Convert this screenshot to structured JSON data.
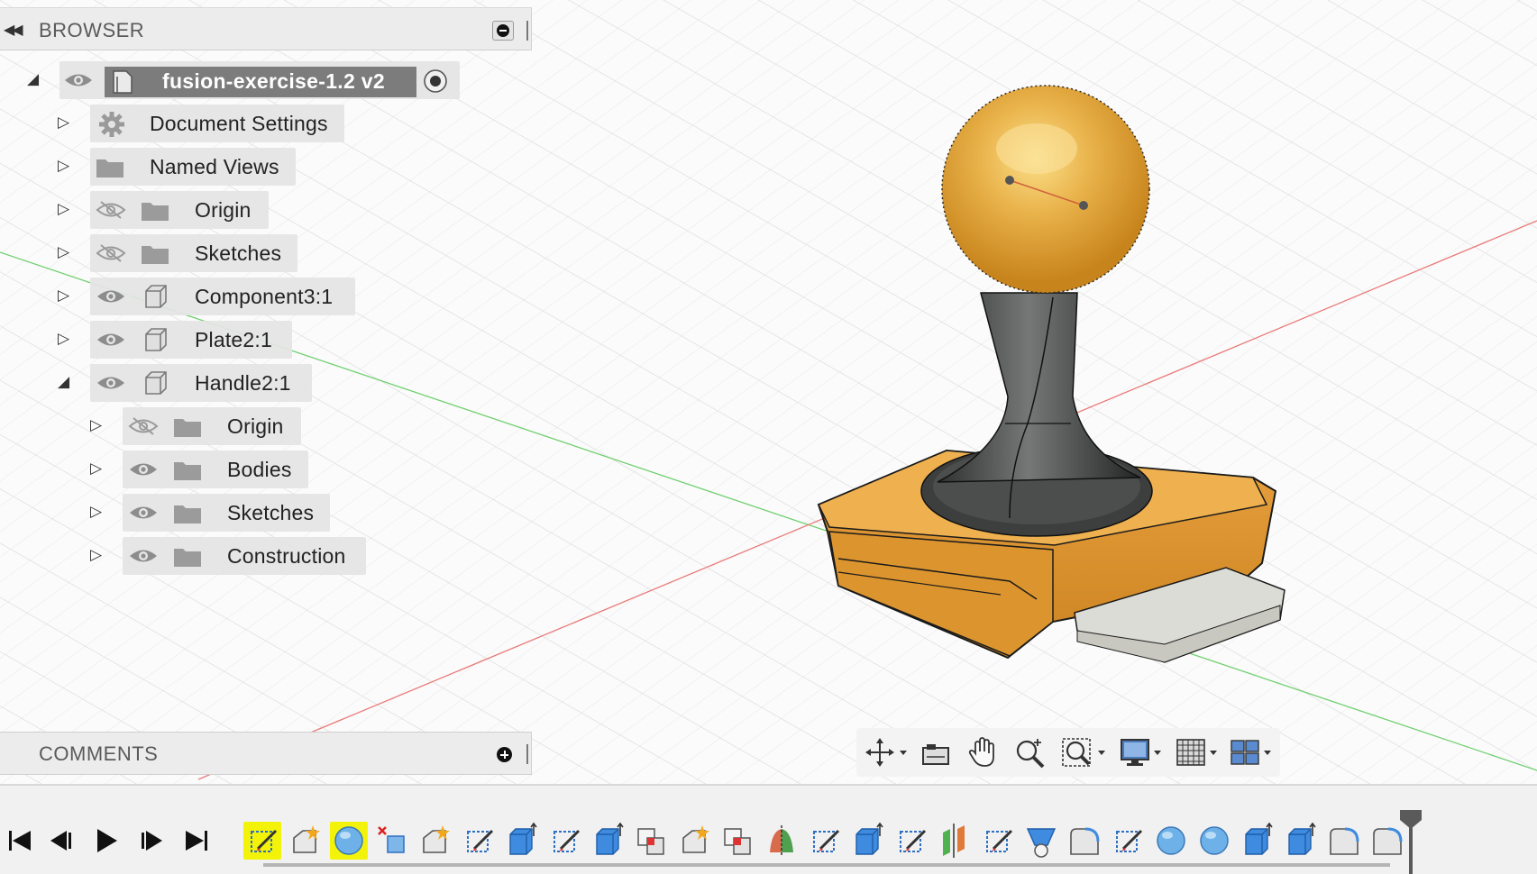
{
  "browser": {
    "title": "BROWSER",
    "root": {
      "name": "fusion-exercise-1.2 v2"
    },
    "items": [
      {
        "label": "Document Settings",
        "icon": "gear-icon"
      },
      {
        "label": "Named Views",
        "icon": "folder-icon"
      },
      {
        "label": "Origin",
        "icon": "folder-icon",
        "visible": false
      },
      {
        "label": "Sketches",
        "icon": "folder-icon",
        "visible": false
      },
      {
        "label": "Component3:1",
        "icon": "component-icon",
        "visible": true
      },
      {
        "label": "Plate2:1",
        "icon": "component-icon",
        "visible": true
      },
      {
        "label": "Handle2:1",
        "icon": "component-icon",
        "visible": true,
        "expanded": true,
        "children": [
          {
            "label": "Origin",
            "icon": "folder-icon",
            "visible": false
          },
          {
            "label": "Bodies",
            "icon": "folder-icon",
            "visible": true
          },
          {
            "label": "Sketches",
            "icon": "folder-icon",
            "visible": true
          },
          {
            "label": "Construction",
            "icon": "folder-icon",
            "visible": true
          }
        ]
      }
    ]
  },
  "comments": {
    "title": "COMMENTS"
  },
  "navigation_toolbar": {
    "buttons": [
      "orbit-icon",
      "look-at-icon",
      "pan-icon",
      "zoom-icon",
      "fit-icon",
      "display-settings-icon",
      "grid-icon",
      "viewports-icon"
    ]
  },
  "timeline": {
    "controls": [
      "go-to-start",
      "step-back",
      "play",
      "step-forward",
      "go-to-end"
    ],
    "features": [
      "sketch",
      "point",
      "sphere",
      "delete",
      "point",
      "sketch",
      "extrude",
      "sketch",
      "extrude",
      "combine",
      "point",
      "combine",
      "revolve",
      "sketch",
      "extrude",
      "sketch",
      "split",
      "sketch",
      "loft",
      "fillet",
      "sketch",
      "sphere",
      "sphere",
      "extrude",
      "extrude",
      "fillet",
      "fillet"
    ],
    "selected_feature_indices": [
      0,
      2
    ]
  },
  "colors": {
    "accent_highlight": "#f3f30a",
    "model_orange": "#e8a23a",
    "model_dark": "#3a3b3b",
    "x_axis": "#e35a5a",
    "y_axis": "#5ec55e"
  }
}
